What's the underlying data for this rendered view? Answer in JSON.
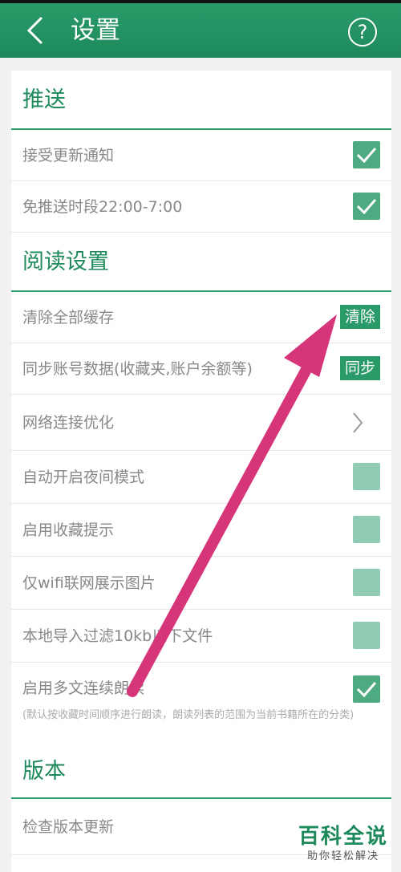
{
  "header": {
    "title": "设置",
    "help_glyph": "?"
  },
  "sections": [
    {
      "title": "推送",
      "rows": [
        {
          "label": "接受更新通知",
          "control": "checkbox",
          "checked": true
        },
        {
          "label": "免推送时段22:00-7:00",
          "control": "checkbox",
          "checked": true
        }
      ]
    },
    {
      "title": "阅读设置",
      "rows": [
        {
          "label": "清除全部缓存",
          "control": "button",
          "button_label": "清除"
        },
        {
          "label": "同步账号数据(收藏夹,账户余额等)",
          "control": "button",
          "button_label": "同步"
        },
        {
          "label": "网络连接优化",
          "control": "chevron"
        },
        {
          "label": "自动开启夜间模式",
          "control": "checkbox",
          "checked": false
        },
        {
          "label": "启用收藏提示",
          "control": "checkbox",
          "checked": false
        },
        {
          "label": "仅wifi联网展示图片",
          "control": "checkbox",
          "checked": false
        },
        {
          "label": "本地导入过滤10kb以下文件",
          "control": "checkbox",
          "checked": false
        },
        {
          "label": "启用多文连续朗读",
          "control": "checkbox",
          "checked": true,
          "note": "(默认按收藏时间顺序进行朗读，朗读列表的范围为当前书籍所在的分类)"
        }
      ]
    },
    {
      "title": "版本",
      "rows": [
        {
          "label": "检查版本更新",
          "control": "none"
        }
      ]
    }
  ],
  "watermark": {
    "title": "百科全说",
    "subtitle": "助你轻松解决"
  },
  "colors": {
    "accent": "#1e8a5b",
    "check_on": "#4eaa80",
    "check_off": "#8fccb3",
    "arrow": "#d6357a"
  }
}
